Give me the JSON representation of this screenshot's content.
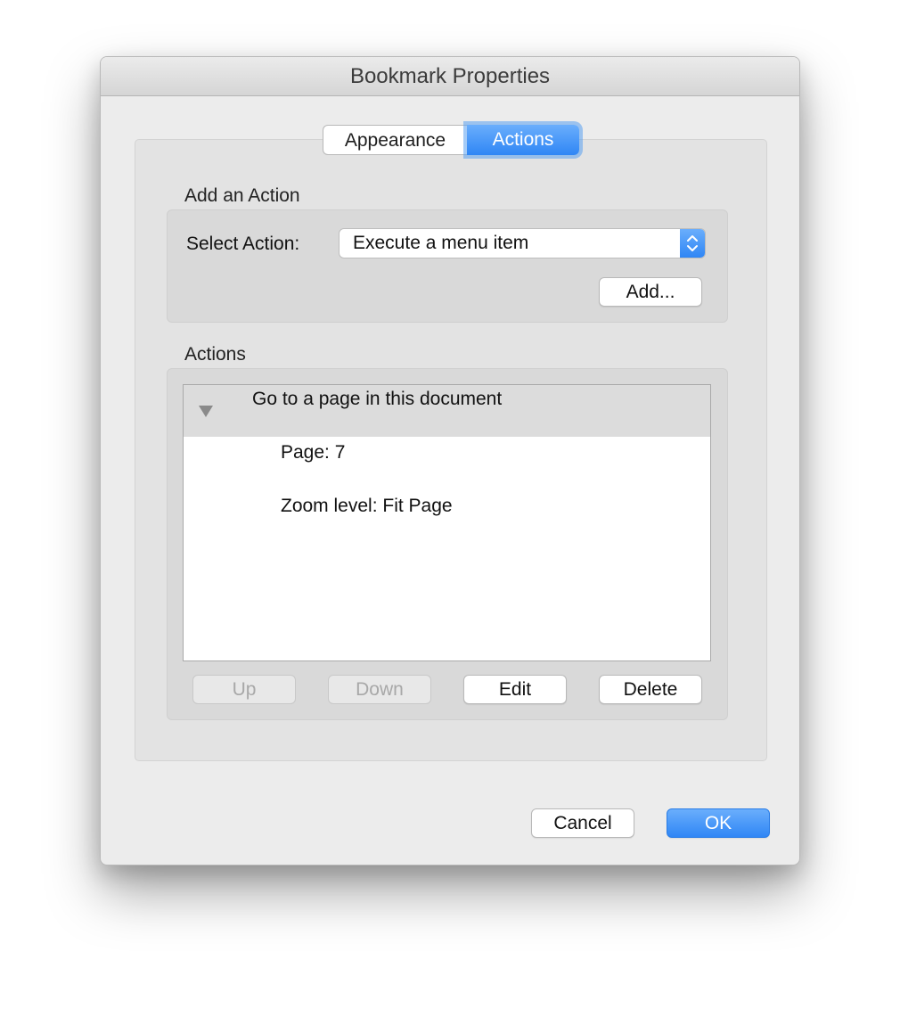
{
  "dialog": {
    "title": "Bookmark Properties"
  },
  "tabs": [
    {
      "label": "Appearance",
      "selected": false
    },
    {
      "label": "Actions",
      "selected": true
    }
  ],
  "add_action": {
    "section_label": "Add an Action",
    "select_label": "Select Action:",
    "select_value": "Execute a menu item",
    "add_button": "Add..."
  },
  "actions": {
    "section_label": "Actions",
    "items": [
      {
        "title": "Go to a page in this document",
        "expanded": true,
        "details": [
          "Page: 7",
          "Zoom level: Fit Page"
        ]
      }
    ],
    "buttons": {
      "up": "Up",
      "down": "Down",
      "edit": "Edit",
      "delete": "Delete"
    }
  },
  "footer": {
    "cancel": "Cancel",
    "ok": "OK"
  },
  "icons": {
    "disclosure": "disclosure-triangle-down-icon",
    "stepper": "up-down-chevron-icon"
  },
  "colors": {
    "accent": "#3b8ef7",
    "window_bg": "#ececec",
    "panel_bg": "#e3e3e3"
  }
}
